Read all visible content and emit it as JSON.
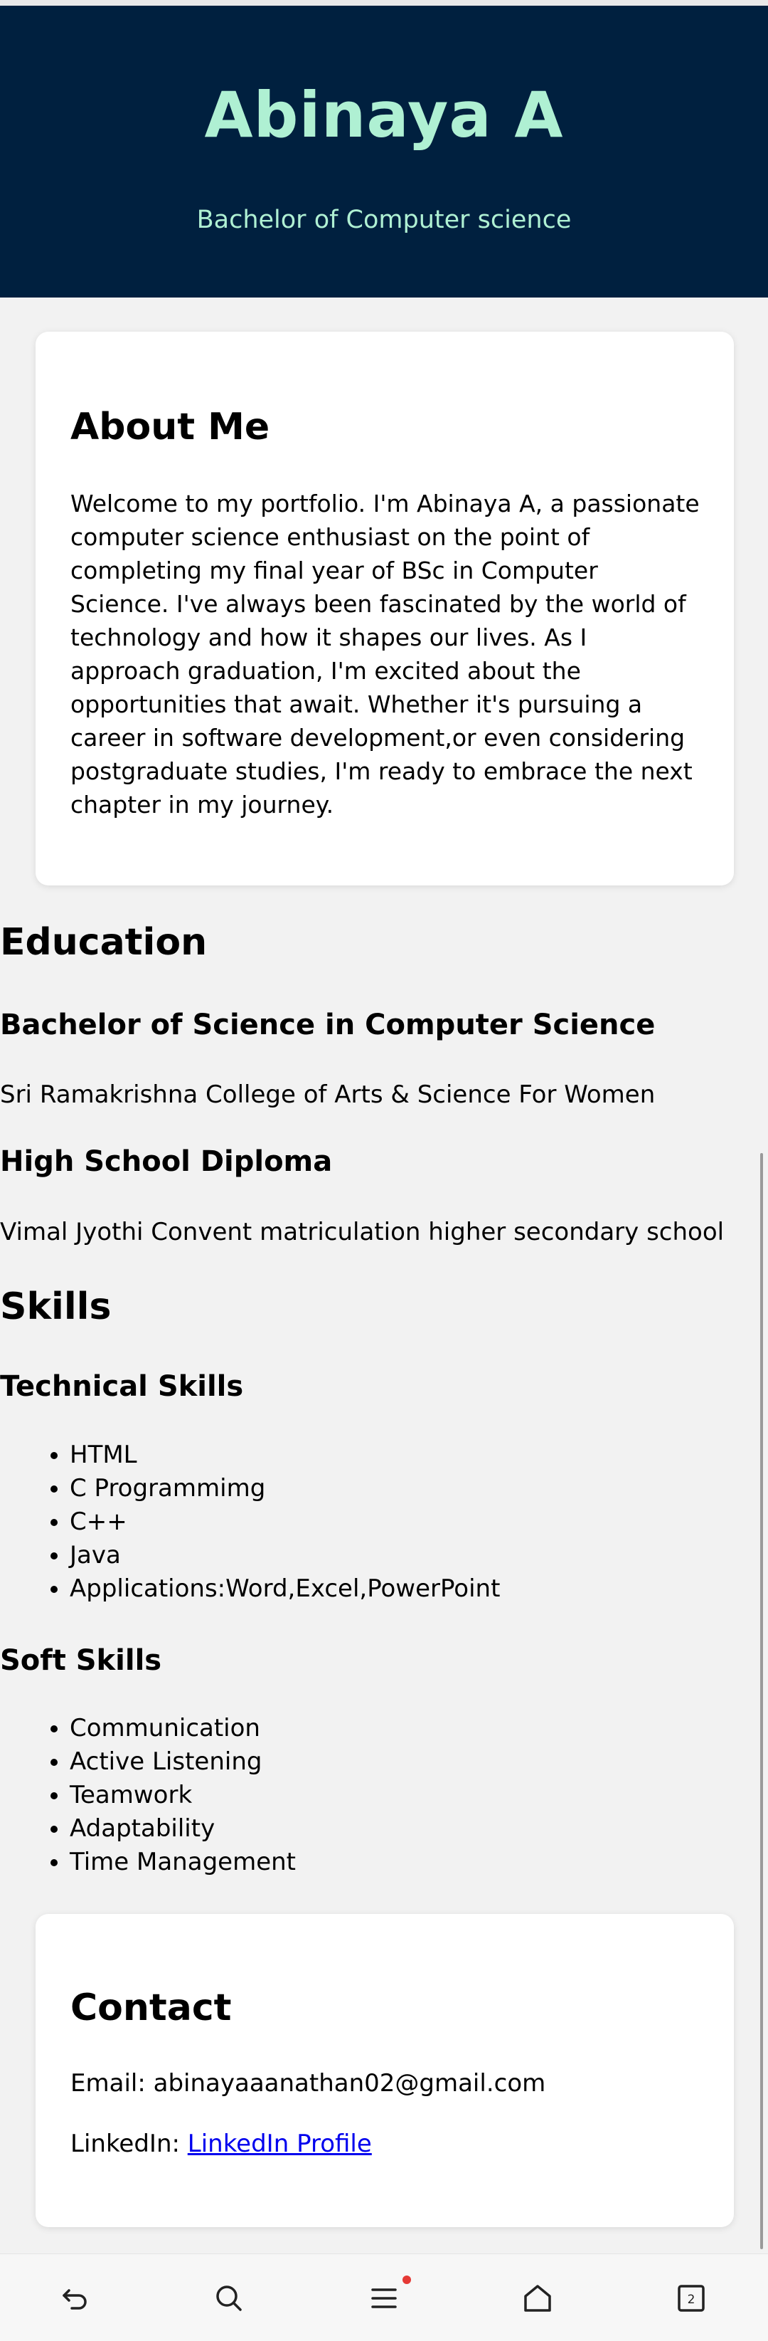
{
  "header": {
    "name": "Abinaya A",
    "subtitle": "Bachelor of Computer science"
  },
  "about": {
    "heading": "About Me",
    "text": "Welcome to my portfolio. I'm Abinaya A, a passionate computer science enthusiast on the point of completing my final year of BSc in Computer Science. I've always been fascinated by the world of technology and how it shapes our lives. As I approach graduation, I'm excited about the opportunities that await. Whether it's pursuing a career in software development,or even considering postgraduate studies, I'm ready to embrace the next chapter in my journey."
  },
  "education": {
    "heading": "Education",
    "entries": [
      {
        "degree": "Bachelor of Science in Computer Science",
        "school": "Sri Ramakrishna College of Arts & Science For Women"
      },
      {
        "degree": "High School Diploma",
        "school": "Vimal Jyothi Convent matriculation higher secondary school"
      }
    ]
  },
  "skills": {
    "heading": "Skills",
    "technical": {
      "heading": "Technical Skills",
      "items": [
        "HTML",
        "C Programmimg",
        "C++",
        "Java",
        "Applications:Word,Excel,PowerPoint"
      ]
    },
    "soft": {
      "heading": "Soft Skills",
      "items": [
        "Communication",
        "Active Listening",
        "Teamwork",
        "Adaptability",
        "Time Management"
      ]
    }
  },
  "contact": {
    "heading": "Contact",
    "email_label": "Email:",
    "email": "abinayaaanathan02@gmail.com",
    "linkedin_label": "LinkedIn:",
    "linkedin_link": "LinkedIn Profile"
  },
  "navbar": {
    "icons": [
      "back-icon",
      "search-icon",
      "menu-icon",
      "home-icon",
      "tabs-icon"
    ],
    "tab_count": "2",
    "notification_dot_color": "#e53935"
  },
  "colors": {
    "header_bg": "#00203f",
    "header_text": "#aff0d3",
    "link": "#0000ee"
  }
}
